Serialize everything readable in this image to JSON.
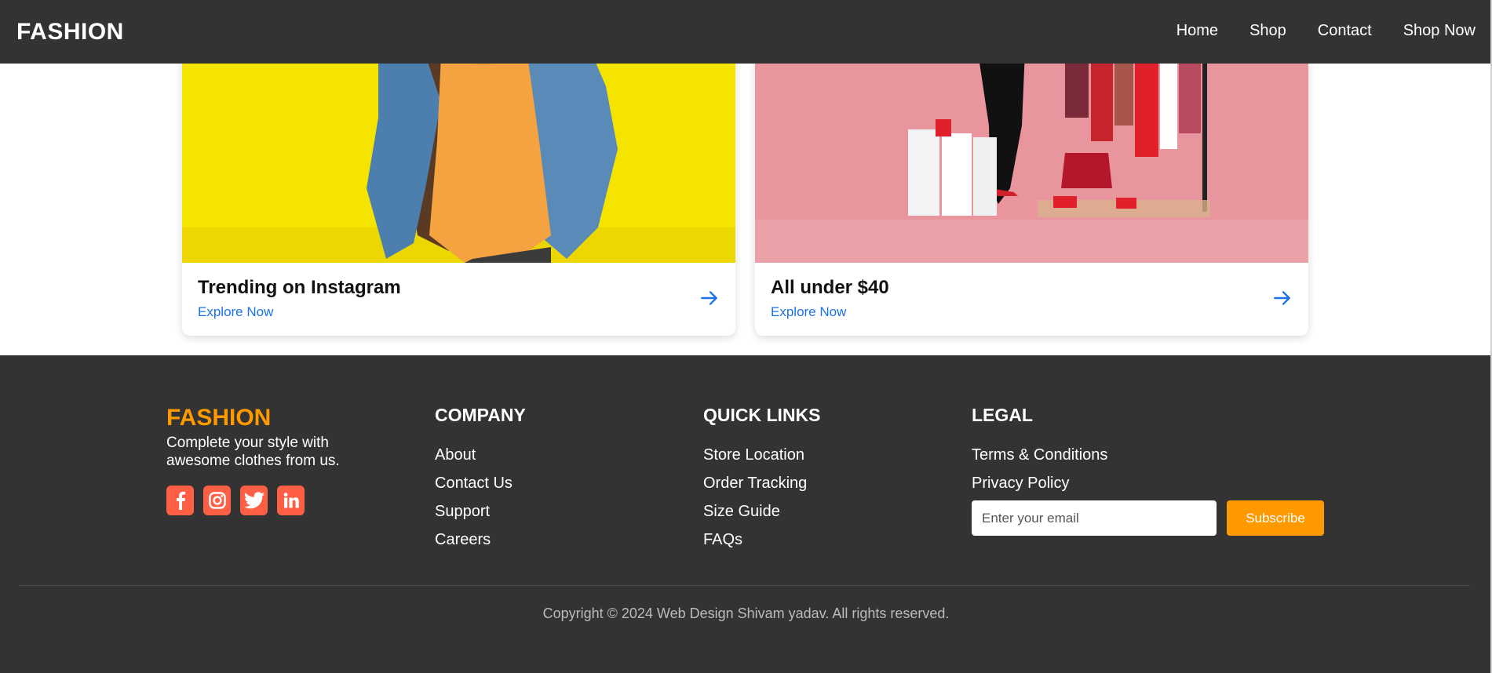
{
  "header": {
    "brand": "FASHION",
    "nav": [
      "Home",
      "Shop",
      "Contact",
      "Shop Now"
    ]
  },
  "cards": [
    {
      "title": "Trending on Instagram",
      "link": "Explore Now",
      "image": "woman-denim-jacket-yellow-wall"
    },
    {
      "title": "All under $40",
      "link": "Explore Now",
      "image": "clothes-rack-shoes-pink"
    }
  ],
  "footer": {
    "brand": "FASHION",
    "tagline": "Complete your style with awesome clothes from us.",
    "socials": [
      "facebook-icon",
      "instagram-icon",
      "twitter-icon",
      "linkedin-icon"
    ],
    "company": {
      "heading": "COMPANY",
      "links": [
        "About",
        "Contact Us",
        "Support",
        "Careers"
      ]
    },
    "quick_links": {
      "heading": "QUICK LINKS",
      "links": [
        "Store Location",
        "Order Tracking",
        "Size Guide",
        "FAQs"
      ]
    },
    "legal": {
      "heading": "LEGAL",
      "links": [
        "Terms & Conditions",
        "Privacy Policy"
      ]
    },
    "subscribe": {
      "placeholder": "Enter your email",
      "button": "Subscribe"
    },
    "copyright": "Copyright © 2024 Web Design Shivam yadav. All rights reserved."
  },
  "colors": {
    "header_bg": "#333333",
    "accent_orange": "#ff9900",
    "social_bg": "#ff5f45",
    "link_blue": "#1a73e8"
  }
}
